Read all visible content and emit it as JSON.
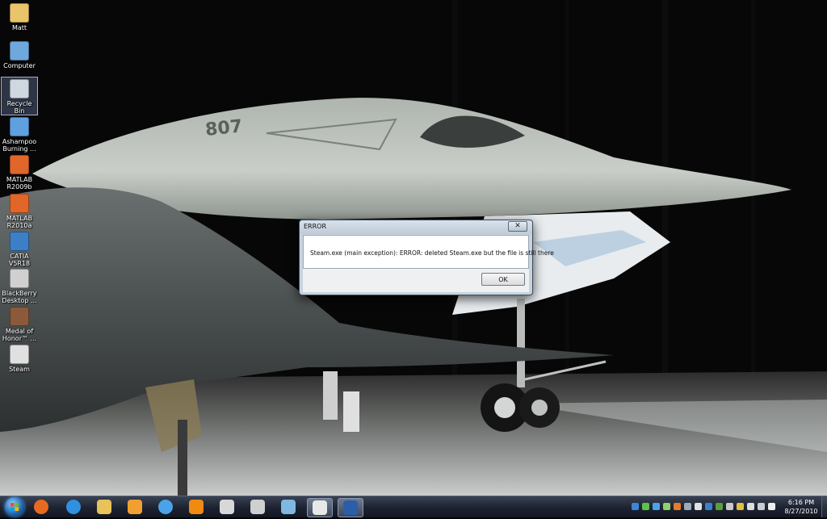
{
  "desktop": {
    "icons": [
      {
        "label": "Matt",
        "icon": "user-folder-icon"
      },
      {
        "label": "Computer",
        "icon": "computer-icon"
      },
      {
        "label": "Recycle Bin",
        "icon": "recycle-bin-icon"
      },
      {
        "label": "Ashampoo\nBurning ...",
        "icon": "ashampoo-icon"
      },
      {
        "label": "MATLAB\nR2009b",
        "icon": "matlab-icon"
      },
      {
        "label": "MATLAB\nR2010a",
        "icon": "matlab-icon"
      },
      {
        "label": "CATIA V5R18",
        "icon": "catia-icon"
      },
      {
        "label": "BlackBerry\nDesktop ...",
        "icon": "blackberry-icon"
      },
      {
        "label": "Medal of\nHonor™ ...",
        "icon": "medal-of-honor-icon"
      },
      {
        "label": "Steam",
        "icon": "steam-icon"
      }
    ],
    "wallpaper_text": "807"
  },
  "dialog": {
    "title": "ERROR",
    "close_label": "✕",
    "message": "Steam.exe (main exception): ERROR: deleted Steam.exe but the file is still there",
    "ok_label": "OK"
  },
  "taskbar": {
    "pinned": [
      {
        "icon": "firefox-icon",
        "color": "#e66a1f"
      },
      {
        "icon": "internet-explorer-icon",
        "color": "#2f8fe0"
      },
      {
        "icon": "windows-explorer-icon",
        "color": "#e8c25a"
      },
      {
        "icon": "outlook-icon",
        "color": "#f0a030"
      },
      {
        "icon": "itunes-icon",
        "color": "#4aa3e8"
      },
      {
        "icon": "vlc-icon",
        "color": "#f08a10"
      },
      {
        "icon": "movie-maker-icon",
        "color": "#d8d8d8"
      },
      {
        "icon": "sync-icon",
        "color": "#cfcfcf"
      },
      {
        "icon": "network-tool-icon",
        "color": "#7fb8e0"
      },
      {
        "icon": "steam-icon",
        "color": "#e8e8e8"
      },
      {
        "icon": "photoshop-icon",
        "color": "#2b5ea8"
      }
    ],
    "clock": {
      "time": "6:16 PM",
      "date": "8/27/2010"
    }
  },
  "colors": {
    "dialog_bg": "#c8d3de",
    "taskbar": "#1c2230",
    "accent": "#2f8fe0"
  }
}
